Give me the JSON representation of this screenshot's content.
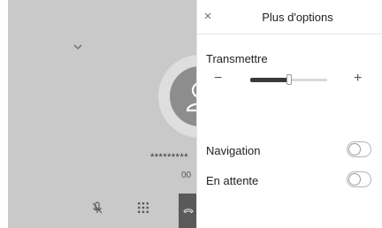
{
  "call": {
    "caller_number": "*********",
    "call_timer": "00"
  },
  "icons": {
    "collapse": "chevron-down-icon",
    "avatar": "person-icon",
    "mute": "mic-off-icon",
    "keypad": "keypad-icon",
    "end_call": "phone-hangup-icon",
    "close": "close-icon"
  },
  "panel": {
    "close_label": "×",
    "title": "Plus d'options",
    "volume": {
      "label": "Transmettre",
      "minus_label": "−",
      "plus_label": "+",
      "level": 0.5
    },
    "toggles": [
      {
        "label": "Navigation",
        "on": false
      },
      {
        "label": "En attente",
        "on": false
      }
    ]
  },
  "colors": {
    "dim_overlay": "#c9c9c9",
    "avatar": "#8d8d8d",
    "end_call": "#5a5a5a",
    "slider_fill": "#3a3a3a"
  }
}
